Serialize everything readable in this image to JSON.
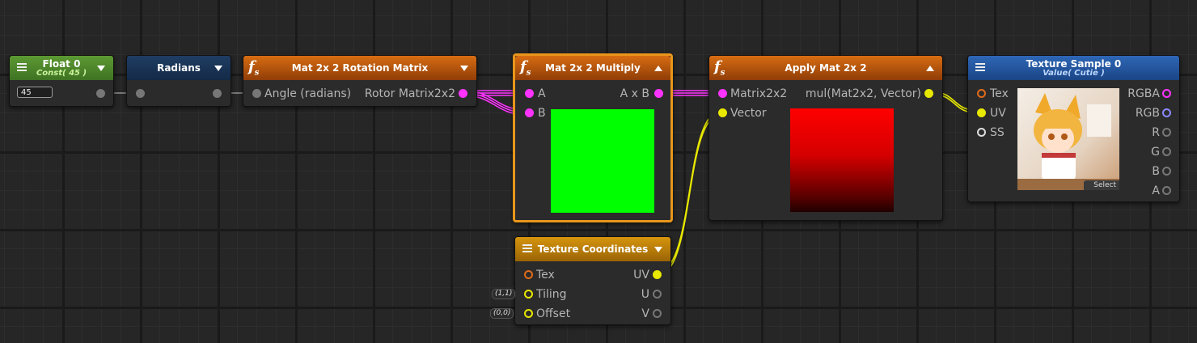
{
  "colors": {
    "magenta": "#ff00ff",
    "yellow": "#e8e800",
    "orange": "#e06b1a",
    "grey": "#777777",
    "preview_green": "#00ff00",
    "preview_red": "#ff0000"
  },
  "nodes": {
    "float0": {
      "title": "Float 0",
      "subtitle": "Const( 45 )",
      "value": "45"
    },
    "radians": {
      "title": "Radians"
    },
    "rotation": {
      "title": "Mat 2x 2 Rotation Matrix",
      "in_angle": "Angle (radians)",
      "out_rotor": "Rotor Matrix2x2"
    },
    "multiply": {
      "title": "Mat 2x 2 Multiply",
      "in_a": "A",
      "in_b": "B",
      "out": "A x B"
    },
    "apply": {
      "title": "Apply Mat 2x 2",
      "in_matrix": "Matrix2x2",
      "in_vector": "Vector",
      "out": "mul(Mat2x2, Vector)"
    },
    "texsample": {
      "title": "Texture Sample 0",
      "subtitle": "Value( Cutie )",
      "in_tex": "Tex",
      "in_uv": "UV",
      "in_ss": "SS",
      "out_rgba": "RGBA",
      "out_rgb": "RGB",
      "out_r": "R",
      "out_g": "G",
      "out_b": "B",
      "out_a": "A",
      "select_label": "Select"
    },
    "texcoords": {
      "title": "Texture Coordinates",
      "in_tex": "Tex",
      "in_tiling": "Tiling",
      "in_offset": "Offset",
      "tiling_default": "(1,1)",
      "offset_default": "(0,0)",
      "out_uv": "UV",
      "out_u": "U",
      "out_v": "V"
    }
  },
  "icons": [
    "menu-icon",
    "function-icon",
    "dropdown-arrow-icon",
    "collapse-arrow-icon"
  ]
}
